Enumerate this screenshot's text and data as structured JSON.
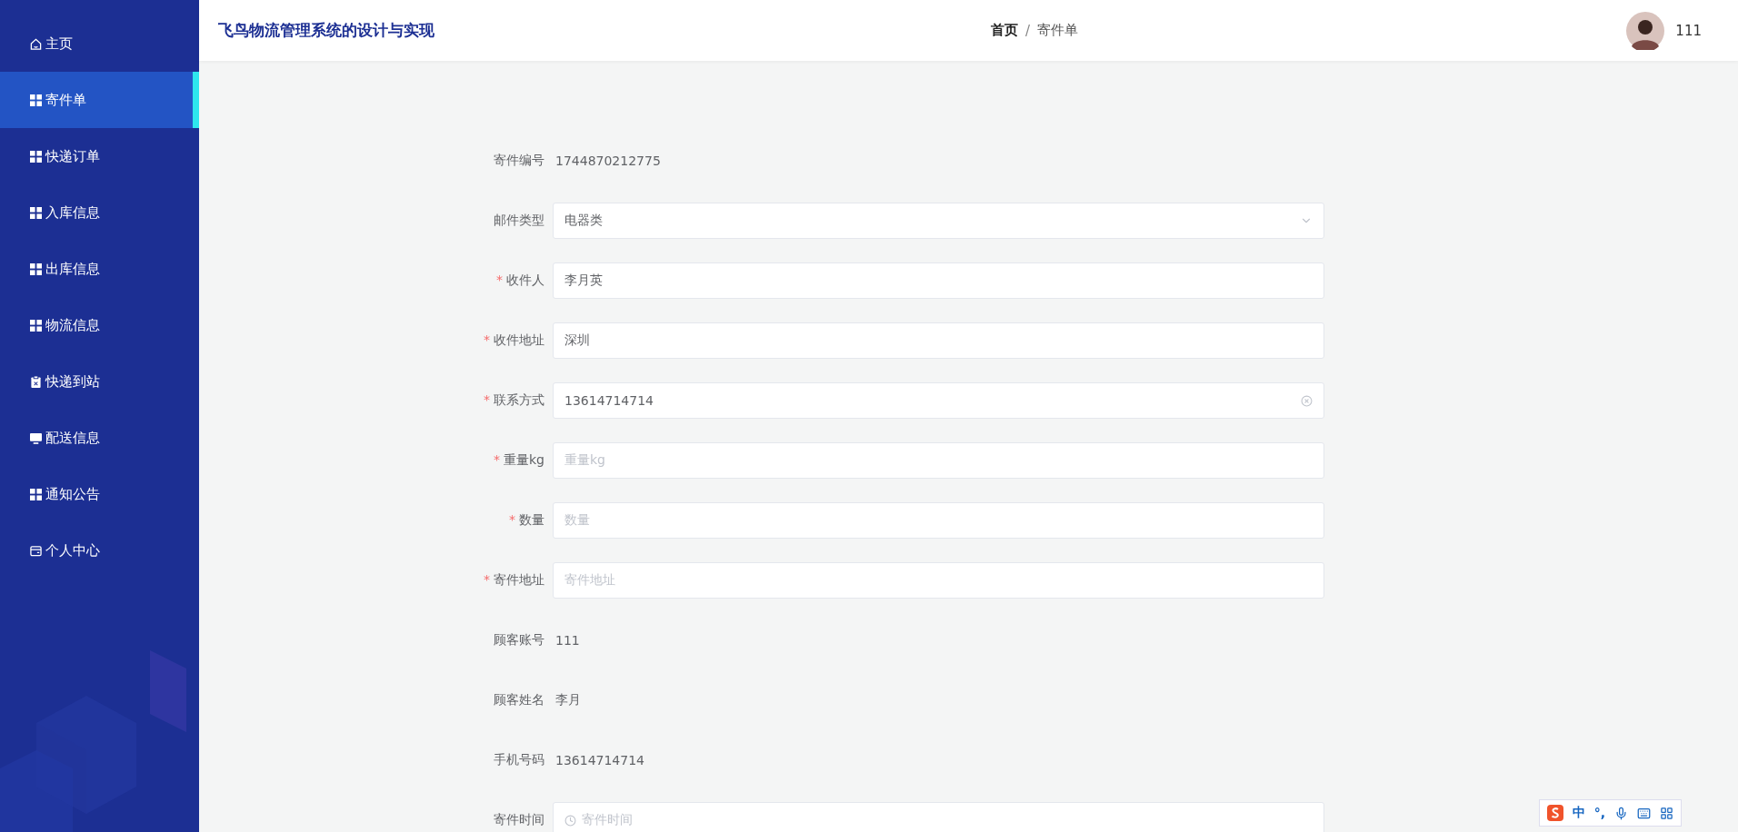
{
  "header": {
    "title": "飞鸟物流管理系统的设计与实现",
    "breadcrumb": [
      {
        "label": "首页",
        "current": false
      },
      {
        "label": "寄件单",
        "current": true
      }
    ],
    "separator": "/",
    "user": {
      "name": "111"
    }
  },
  "sidebar": {
    "items": [
      {
        "label": "主页",
        "kind": "home",
        "selected": false
      },
      {
        "label": "寄件单",
        "kind": "grid",
        "selected": true
      },
      {
        "label": "快递订单",
        "kind": "grid",
        "selected": false
      },
      {
        "label": "入库信息",
        "kind": "grid",
        "selected": false
      },
      {
        "label": "出库信息",
        "kind": "grid",
        "selected": false
      },
      {
        "label": "物流信息",
        "kind": "grid",
        "selected": false
      },
      {
        "label": "快递到站",
        "kind": "clipboard",
        "selected": false
      },
      {
        "label": "配送信息",
        "kind": "monitor",
        "selected": false
      },
      {
        "label": "通知公告",
        "kind": "grid",
        "selected": false
      },
      {
        "label": "个人中心",
        "kind": "card",
        "selected": false
      }
    ]
  },
  "form": {
    "fields": [
      {
        "kind": "text",
        "label": "寄件编号",
        "value": "1744870212775"
      },
      {
        "kind": "select",
        "label": "邮件类型",
        "value": "电器类"
      },
      {
        "kind": "input",
        "label": "收件人",
        "required_mark": "*",
        "value": "李月英"
      },
      {
        "kind": "input",
        "label": "收件地址",
        "required_mark": "*",
        "value": "深圳"
      },
      {
        "kind": "input",
        "label": "联系方式",
        "required_mark": "*",
        "value": "13614714714",
        "clearable": true
      },
      {
        "kind": "input",
        "label": "重量kg",
        "required_mark": "*",
        "placeholder": "重量kg"
      },
      {
        "kind": "input",
        "label": "数量",
        "required_mark": "*",
        "placeholder": "数量"
      },
      {
        "kind": "input",
        "label": "寄件地址",
        "required_mark": "*",
        "placeholder": "寄件地址"
      },
      {
        "kind": "text",
        "label": "顾客账号",
        "value": "111"
      },
      {
        "kind": "text",
        "label": "顾客姓名",
        "value": "李月"
      },
      {
        "kind": "text",
        "label": "手机号码",
        "value": "13614714714"
      },
      {
        "kind": "date",
        "label": "寄件时间",
        "placeholder": "寄件时间"
      }
    ]
  },
  "ime_toolbar": {
    "mode": "中",
    "punctuation": "°,"
  }
}
